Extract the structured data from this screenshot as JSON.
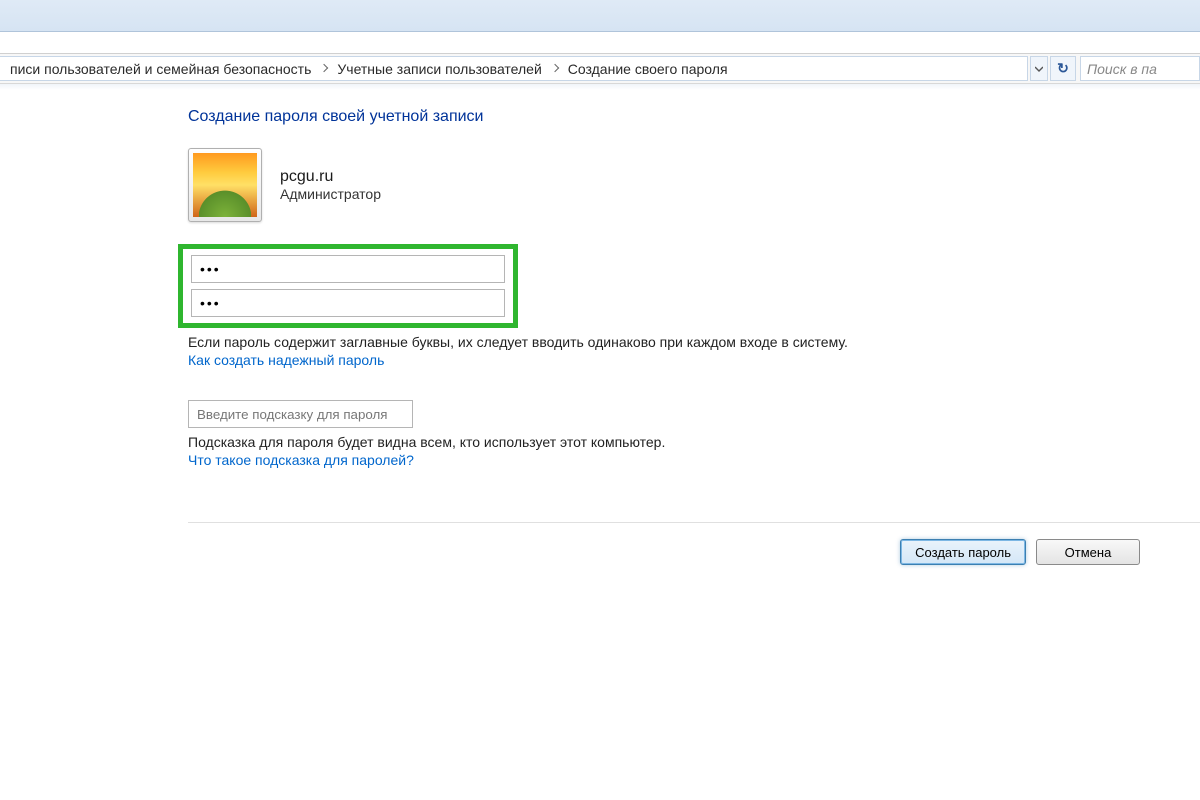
{
  "breadcrumb": {
    "crumb1": "писи пользователей и семейная безопасность",
    "crumb2": "Учетные записи пользователей",
    "crumb3": "Создание своего пароля"
  },
  "toolbar": {
    "search_placeholder": "Поиск в па"
  },
  "page": {
    "title": "Создание пароля своей учетной записи"
  },
  "user": {
    "name": "pcgu.ru",
    "role": "Администратор"
  },
  "form": {
    "password_value": "•••",
    "password_confirm_value": "•••",
    "caps_note": "Если пароль содержит заглавные буквы, их следует вводить одинаково при каждом входе в систему.",
    "how_to_link": "Как создать надежный пароль",
    "hint_placeholder": "Введите подсказку для пароля",
    "hint_visible_note": "Подсказка для пароля будет видна всем, кто использует этот компьютер.",
    "hint_what_link": "Что такое подсказка для паролей?"
  },
  "buttons": {
    "create": "Создать пароль",
    "cancel": "Отмена"
  }
}
